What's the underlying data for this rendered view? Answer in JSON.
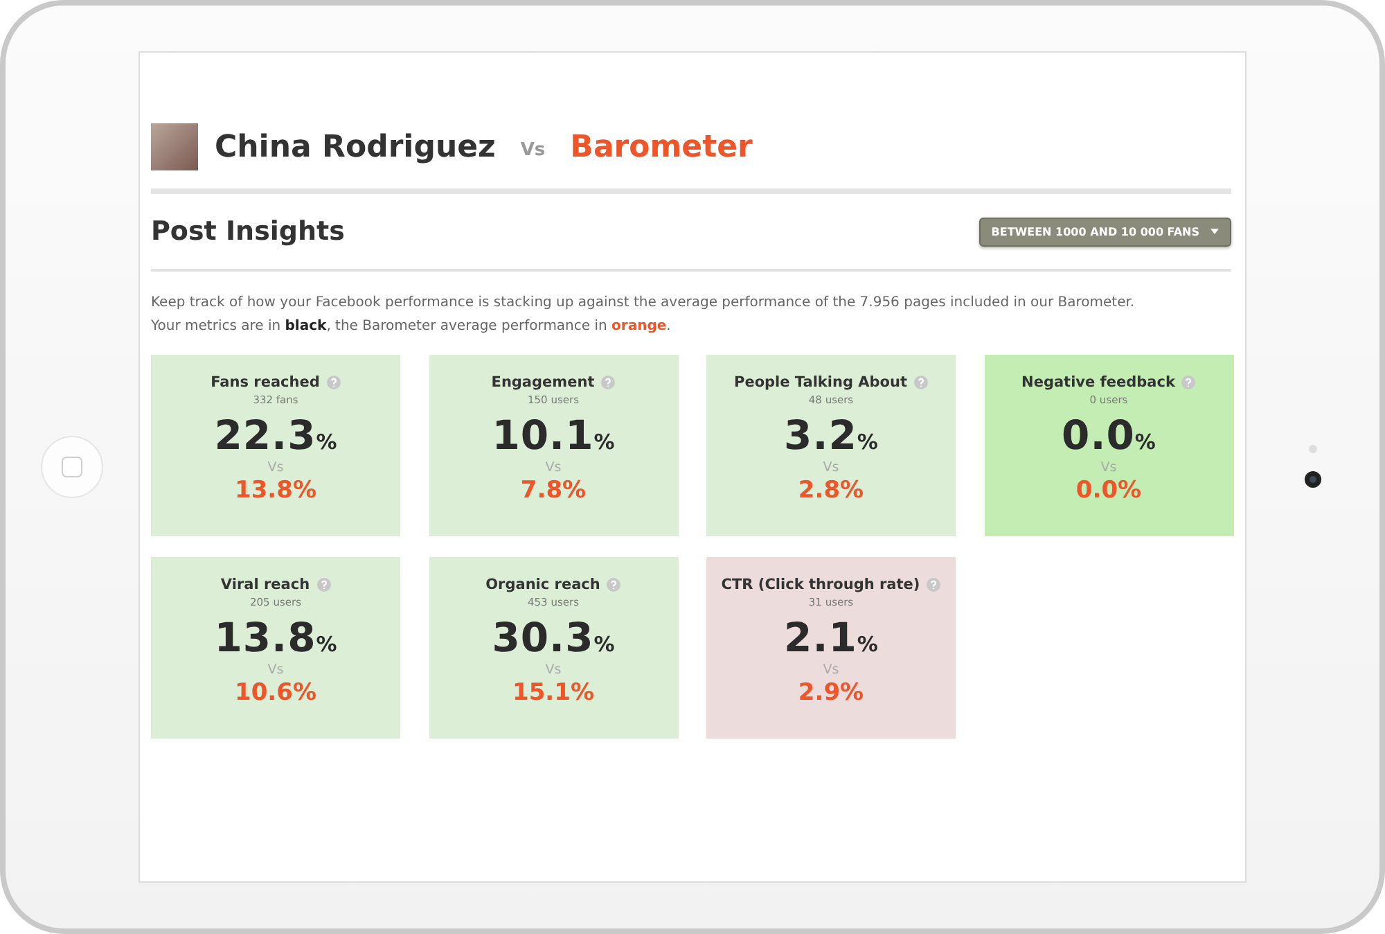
{
  "header": {
    "name": "China Rodriguez",
    "vs": "Vs",
    "rival": "Barometer"
  },
  "section": {
    "title": "Post Insights",
    "filter": "BETWEEN 1000 AND 10 000 FANS"
  },
  "description": [
    "Keep track of how your Facebook performance is stacking up against the average performance of the 7.956 pages included in our Barometer.",
    "Your metrics are in **black**, the Barometer average performance in **orange**."
  ],
  "metrics": [
    {
      "title": "Fans reached",
      "count": "332 fans",
      "value": "22.3",
      "unit": "%",
      "vs": "Vs",
      "barometer": "13.8%",
      "color": "#dcefd6"
    },
    {
      "title": "Engagement",
      "count": "150 users",
      "value": "10.1",
      "unit": "%",
      "vs": "Vs",
      "barometer": "7.8%",
      "color": "#dcefd6"
    },
    {
      "title": "People Talking About",
      "count": "48 users",
      "value": "3.2",
      "unit": "%",
      "vs": "Vs",
      "barometer": "2.8%",
      "color": "#dcefd6"
    },
    {
      "title": "Negative feedback",
      "count": "0 users",
      "value": "0.0",
      "unit": "%",
      "vs": "Vs",
      "barometer": "0.0%",
      "color": "#c4edb4"
    },
    {
      "title": "Viral reach",
      "count": "205 users",
      "value": "13.8",
      "unit": "%",
      "vs": "Vs",
      "barometer": "10.6%",
      "color": "#dcefd6"
    },
    {
      "title": "Organic reach",
      "count": "453 users",
      "value": "30.3",
      "unit": "%",
      "vs": "Vs",
      "barometer": "15.1%",
      "color": "#dcefd6"
    },
    {
      "title": "CTR (Click through rate)",
      "count": "31 users",
      "value": "2.1",
      "unit": "%",
      "vs": "Vs",
      "barometer": "2.9%",
      "color": "#ecdcdc"
    }
  ]
}
